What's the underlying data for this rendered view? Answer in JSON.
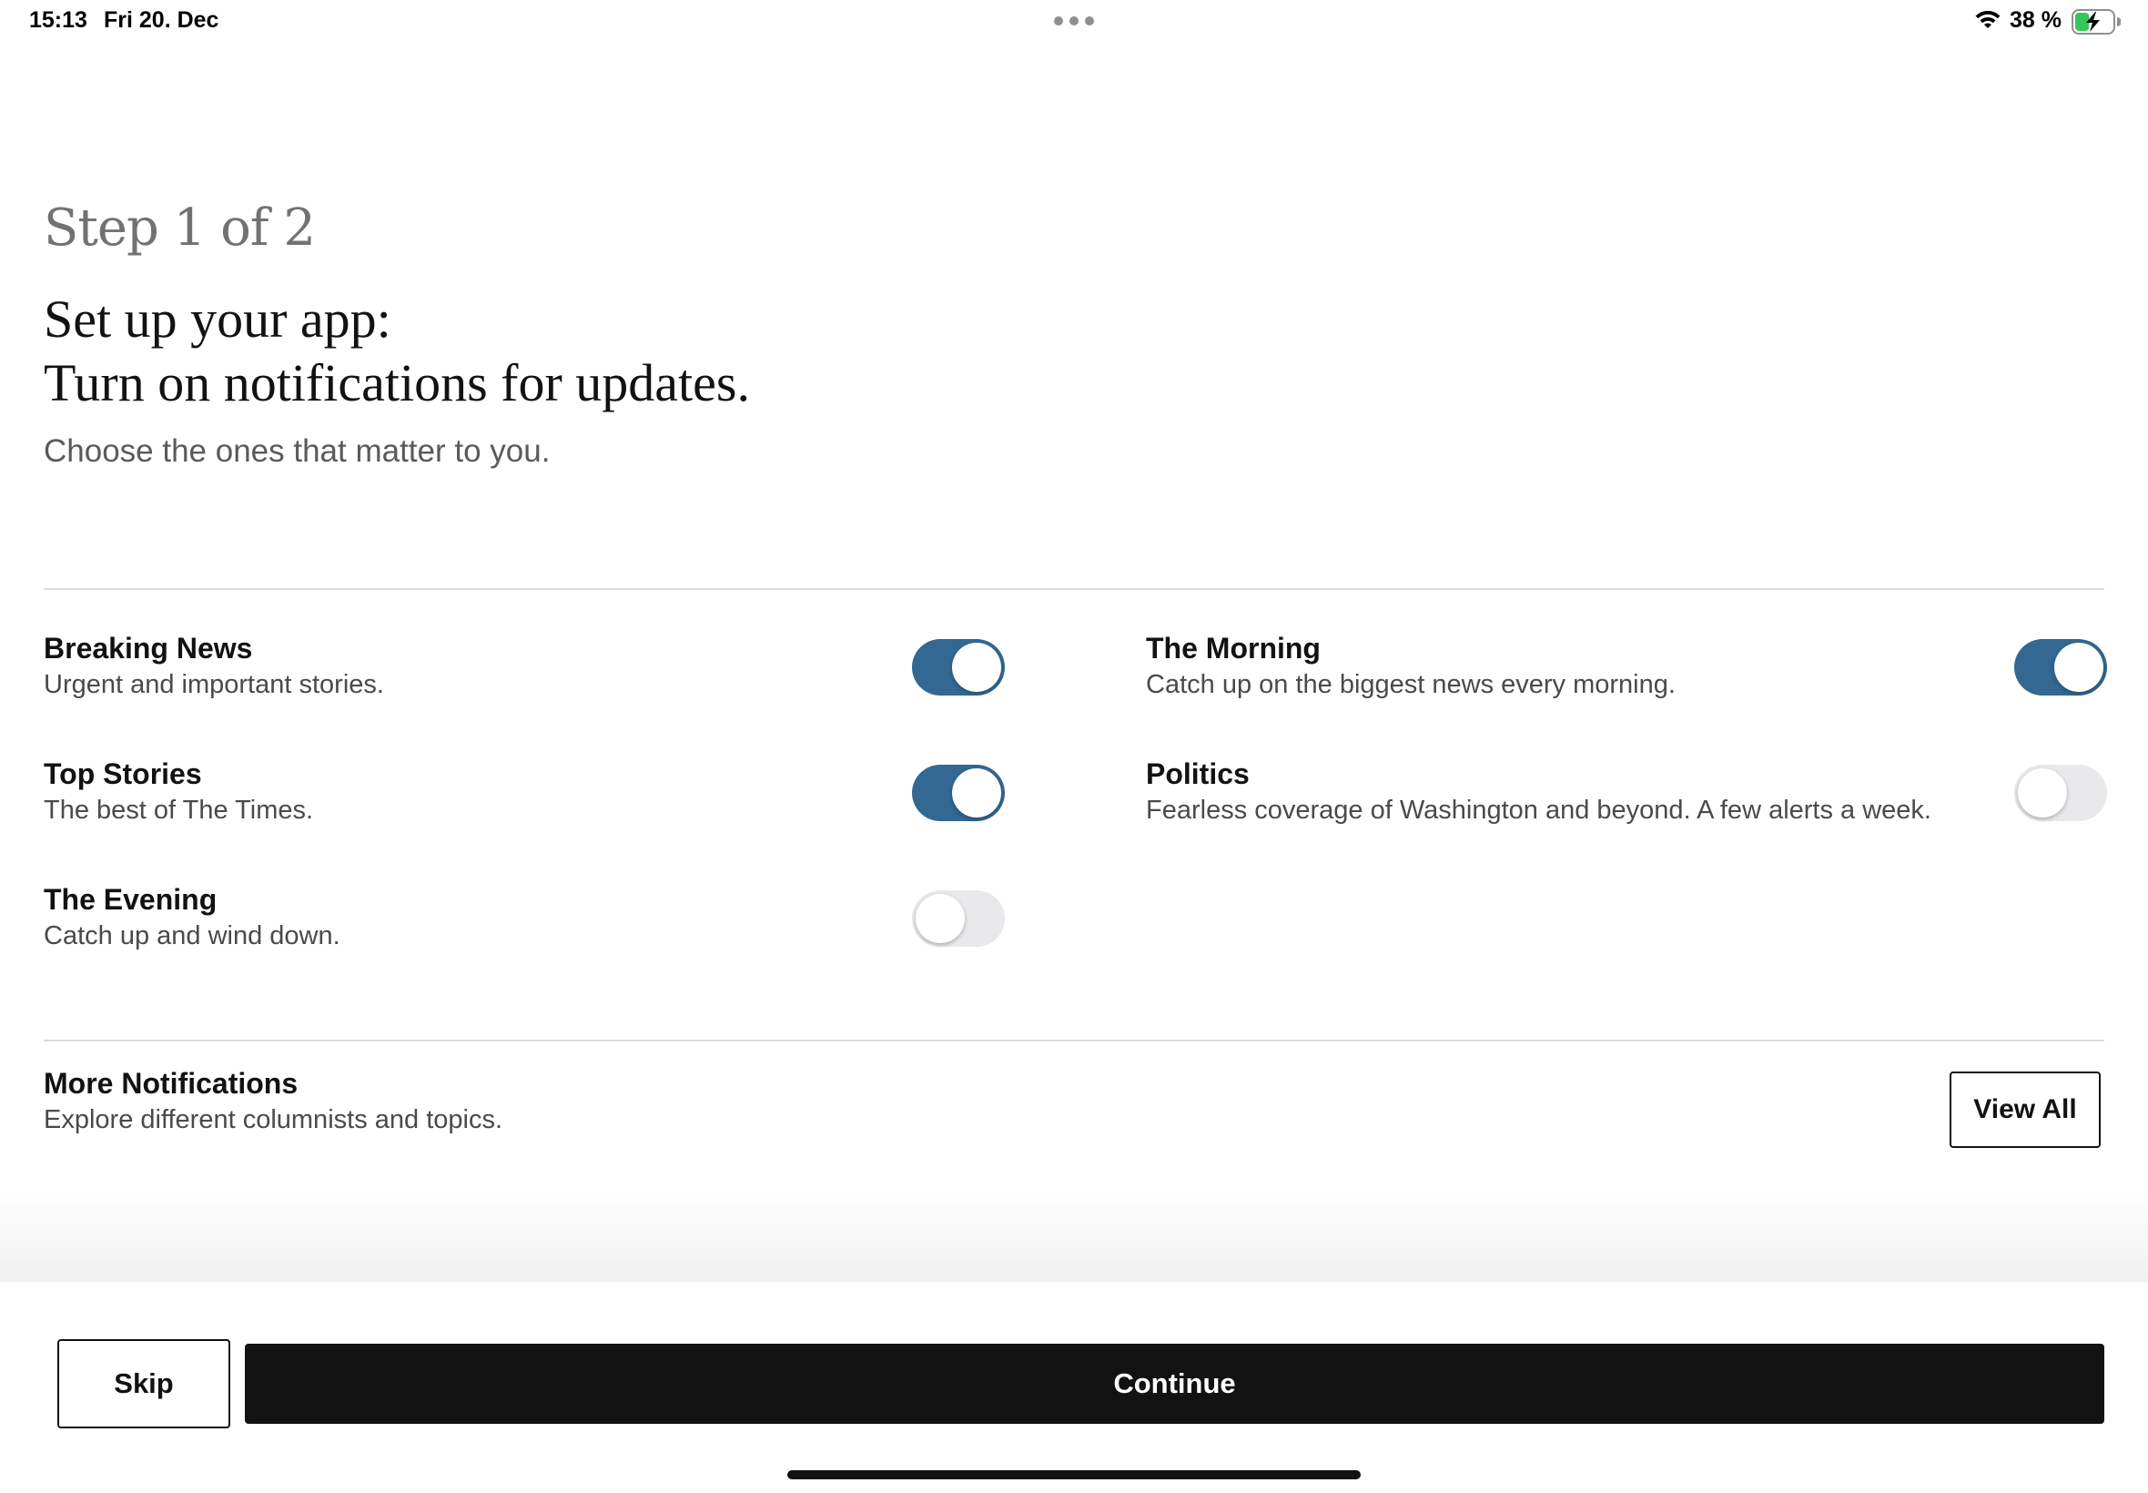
{
  "status_bar": {
    "time": "15:13",
    "date": "Fri 20. Dec",
    "battery_percent": "38 %",
    "battery_level": 0.38,
    "battery_charging": true,
    "battery_color": "#34c759"
  },
  "header": {
    "step": "Step 1 of 2",
    "title_line1": "Set up your app:",
    "title_line2": "Turn on notifications for updates.",
    "subtitle": "Choose the ones that matter to you."
  },
  "notifications": [
    {
      "title": "Breaking News",
      "description": "Urgent and important stories.",
      "enabled": true
    },
    {
      "title": "Top Stories",
      "description": "The best of The Times.",
      "enabled": true
    },
    {
      "title": "The Evening",
      "description": "Catch up and wind down.",
      "enabled": false
    },
    {
      "title": "The Morning",
      "description": "Catch up on the biggest news every morning.",
      "enabled": true
    },
    {
      "title": "Politics",
      "description": "Fearless coverage of Washington and beyond. A few alerts a week.",
      "enabled": false
    }
  ],
  "more": {
    "title": "More Notifications",
    "description": "Explore different columnists and topics.",
    "button_label": "View All"
  },
  "footer": {
    "skip_label": "Skip",
    "continue_label": "Continue"
  },
  "colors": {
    "toggle_on": "#326891",
    "toggle_off": "#e9e9eb",
    "primary_button": "#121212"
  }
}
